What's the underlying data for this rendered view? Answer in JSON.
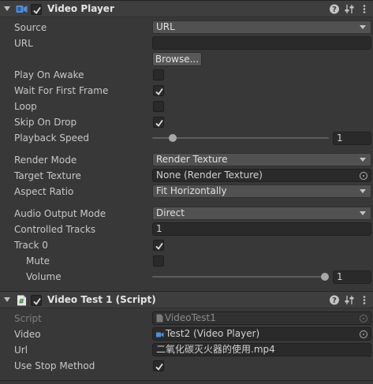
{
  "video_player": {
    "title": "Video Player",
    "fields": {
      "source": {
        "label": "Source",
        "value": "URL"
      },
      "url": {
        "label": "URL",
        "value": ""
      },
      "browse_button": "Browse...",
      "play_on_awake": {
        "label": "Play On Awake",
        "checked": false
      },
      "wait_for_first_frame": {
        "label": "Wait For First Frame",
        "checked": true
      },
      "loop": {
        "label": "Loop",
        "checked": false
      },
      "skip_on_drop": {
        "label": "Skip On Drop",
        "checked": true
      },
      "playback_speed": {
        "label": "Playback Speed",
        "value": "1",
        "slider_fraction": 0.1
      },
      "render_mode": {
        "label": "Render Mode",
        "value": "Render Texture"
      },
      "target_texture": {
        "label": "Target Texture",
        "value": "None (Render Texture)"
      },
      "aspect_ratio": {
        "label": "Aspect Ratio",
        "value": "Fit Horizontally"
      },
      "audio_output_mode": {
        "label": "Audio Output Mode",
        "value": "Direct"
      },
      "controlled_tracks": {
        "label": "Controlled Tracks",
        "value": "1"
      },
      "track_0": {
        "label": "Track 0",
        "checked": true
      },
      "mute": {
        "label": "Mute",
        "checked": false
      },
      "volume": {
        "label": "Volume",
        "value": "1",
        "slider_fraction": 1.0
      }
    }
  },
  "video_test": {
    "title": "Video Test 1 (Script)",
    "fields": {
      "script": {
        "label": "Script",
        "value": "VideoTest1"
      },
      "video": {
        "label": "Video",
        "value": "Test2 (Video Player)"
      },
      "url": {
        "label": "Url",
        "value": "二氧化碳灭火器的使用.mp4"
      },
      "use_stop_method": {
        "label": "Use Stop Method",
        "checked": true
      }
    }
  },
  "icons": {
    "video_player": "video-camera-icon",
    "script": "script-hash-icon",
    "help": "help-icon",
    "presets": "presets-sliders-icon",
    "menu": "kebab-menu-icon",
    "object_picker": "target-picker-icon"
  },
  "colors": {
    "background": "#383838",
    "header": "#3e3e3e",
    "video_icon": "#4f8fd8",
    "field": "#2a2a2a",
    "dropdown": "#515151"
  }
}
